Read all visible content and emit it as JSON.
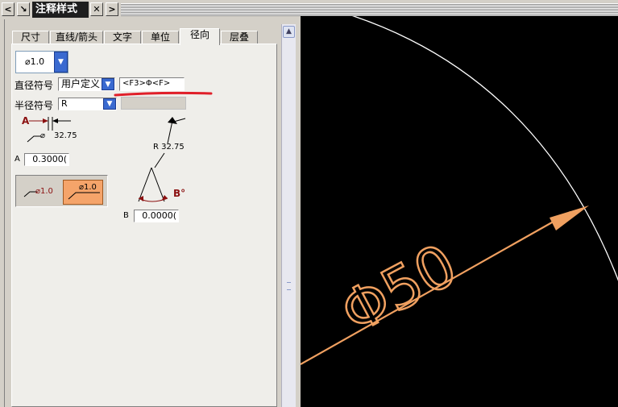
{
  "window": {
    "title": "注释样式"
  },
  "titlebar": {
    "left_arrow": "<",
    "right_arrow": ">",
    "close": "✕",
    "pin": "↘"
  },
  "tabs": [
    "尺寸",
    "直线/箭头",
    "文字",
    "单位",
    "径向",
    "层叠"
  ],
  "active_tab": "径向",
  "style_combo": {
    "value": "⌀1.0"
  },
  "diameter_symbol": {
    "label": "直径符号",
    "value": "用户定义",
    "text": "<F3>Φ<F>"
  },
  "radius_symbol": {
    "label": "半径符号",
    "value": "R",
    "text": ""
  },
  "diagram_a": {
    "marker": "A",
    "value": "32.75",
    "symbol": "⌀"
  },
  "field_a": {
    "label": "A",
    "value": "0.3000("
  },
  "diagram_b": {
    "marker": "B°",
    "value": "R 32.75"
  },
  "field_b": {
    "label": "B",
    "value": "0.0000("
  },
  "placement_buttons": [
    {
      "label": "⌀1.0"
    },
    {
      "label": "⌀1.0"
    }
  ],
  "canvas": {
    "dimension_text": "Φ50"
  },
  "colors": {
    "canvas_bg": "#000000",
    "dimension": "#f0a060",
    "circle": "#ffffff",
    "annotation": "#e0202a",
    "marker": "#8b1010",
    "accent_button": "#f5a46a"
  }
}
